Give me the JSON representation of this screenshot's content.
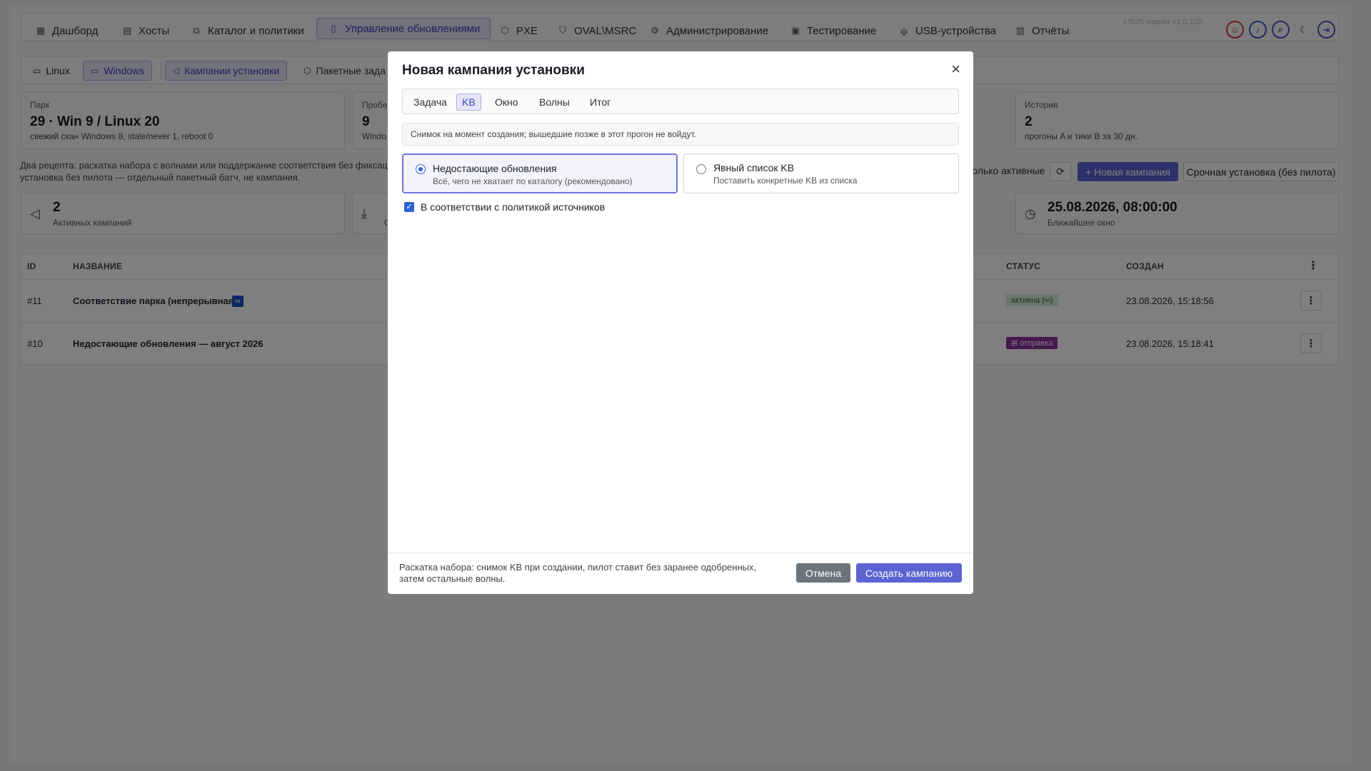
{
  "nav": {
    "items": [
      {
        "label": "Дашборд",
        "icon": "dashboard-icon"
      },
      {
        "label": "Хосты",
        "icon": "server-icon"
      },
      {
        "label": "Каталог и политики",
        "icon": "catalog-icon"
      },
      {
        "label": "Управление обновлениями",
        "icon": "update-icon"
      },
      {
        "label": "PXE",
        "icon": "cube-icon"
      },
      {
        "label": "OVAL\\MSRC",
        "icon": "shield-icon"
      },
      {
        "label": "Администрирование",
        "icon": "admin-icon"
      },
      {
        "label": "Тестирование",
        "icon": "test-icon"
      },
      {
        "label": "USB-устройства",
        "icon": "usb-icon"
      },
      {
        "label": "Отчёты",
        "icon": "report-icon"
      }
    ],
    "version": "LSUS master v1.0.102"
  },
  "subnav": {
    "linux": "Linux",
    "windows": "Windows",
    "campaigns": "Кампании установки",
    "batch": "Пакетные зада"
  },
  "stats": {
    "park": {
      "label": "Парк",
      "value": "29 · Win 9 / Linux 20",
      "hint": "свежий скан Windows 8, stale/never 1, reboot 0"
    },
    "gaps": {
      "label": "Пробе",
      "value": "9",
      "hint": "Windo"
    },
    "history": {
      "label": "История",
      "value": "2",
      "hint": "прогоны A и тики B за 30 дн."
    }
  },
  "description": "Два рецепта: раскатка набора с волнами или поддержание соответствия без фиксаци установка без пилота — отдельный пакетный батч, не кампания.",
  "toolbar": {
    "only_active": "только активные",
    "refresh": "⟳",
    "new_campaign": "+ Новая кампания",
    "urgent": "Срочная установка (без пилота)"
  },
  "kpis": {
    "active": {
      "value": "2",
      "label": "Активных кампаний"
    },
    "second": {
      "value": "",
      "label": "С"
    },
    "nearest": {
      "value": "25.08.2026, 08:00:00",
      "label": "Ближайшее окно"
    }
  },
  "table": {
    "headers": {
      "id": "ID",
      "name": "НАЗВАНИЕ",
      "status": "СТАТУС",
      "created": "СОЗДАН"
    },
    "rows": [
      {
        "id": "#11",
        "name": "Соответствие парка (непрерывная)",
        "tag": "∞",
        "status": "активна (∞)",
        "created": "23.08.2026, 15:18:56"
      },
      {
        "id": "#10",
        "name": "Недостающие обновления — август 2026",
        "status": "⊞ отправка",
        "created": "23.08.2026, 15:18:41"
      }
    ]
  },
  "modal": {
    "title": "Новая кампания установки",
    "close": "×",
    "tabs": [
      "Задача",
      "KB",
      "Окно",
      "Волны",
      "Итог"
    ],
    "note": "Снимок на момент создания; вышедшие позже в этот прогон не войдут.",
    "option_missing": {
      "title": "Недостающие обновления",
      "subtitle": "Всё, чего не хватает по каталогу (рекомендовано)"
    },
    "option_explicit": {
      "title": "Явный список KB",
      "subtitle": "Поставить конкретные KB из списка"
    },
    "checkbox": "В соответствии с политикой источников",
    "footer_text": "Раскатка набора: снимок KB при создании, пилот ставит без заранее одобренных, затем остальные волны.",
    "cancel": "Отмена",
    "create": "Создать кампанию"
  },
  "colors": {
    "accent": "#5b63d3",
    "active_bg": "#e4e6f7",
    "status_active": "#d5ecd6",
    "status_send": "#8e2f9f"
  }
}
